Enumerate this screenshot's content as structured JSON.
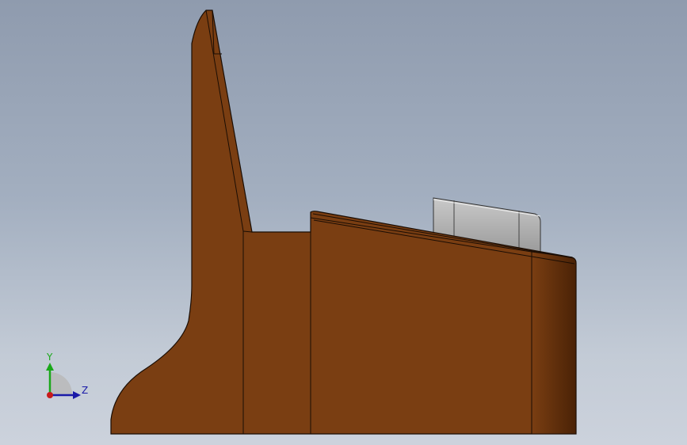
{
  "viewport": {
    "background_top": "#8f9bae",
    "background_bottom": "#ccd2dc"
  },
  "model": {
    "body_color": "#7a3e12",
    "edge_color": "#1a0d04",
    "end_face_color": "#5a2a08",
    "insert_color": "#a9a9a9"
  },
  "triad": {
    "y_label": "Y",
    "z_label": "Z",
    "y_color": "#1aa81a",
    "z_color": "#1a1aa8",
    "x_color": "#c81a1a"
  }
}
